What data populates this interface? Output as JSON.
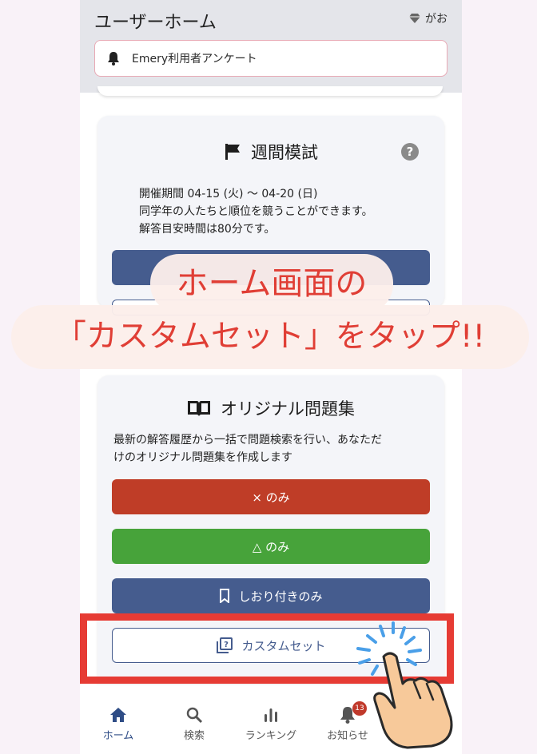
{
  "header": {
    "title": "ユーザーホーム",
    "username": "がお",
    "notice": "Emery利用者アンケート"
  },
  "mock_exam": {
    "title": "週間模試",
    "desc_lines": [
      "開催期間 04-15 (火) 〜 04-20 (日)",
      "同学年の人たちと順位を競うことができます。",
      "解答目安時間は80分です。"
    ]
  },
  "original": {
    "title": "オリジナル問題集",
    "desc_lines": [
      "最新の解答履歴から一括で問題検索を行い、あなただ",
      "けのオリジナル問題集を作成します"
    ],
    "btn_wrong": "× のみ",
    "btn_triangle": "△ のみ",
    "btn_bookmark": "しおり付きのみ",
    "btn_custom": "カスタムセット"
  },
  "nav": {
    "home": "ホーム",
    "search": "検索",
    "ranking": "ランキング",
    "news": "お知らせ",
    "news_badge": "13"
  },
  "annotation": {
    "line1": "ホーム画面の",
    "line2": "「カスタムセット」をタップ!!"
  },
  "colors": {
    "primary": "#455c8e",
    "wrong": "#bf3d27",
    "triangle": "#47a33a",
    "highlight": "#e63b34"
  }
}
